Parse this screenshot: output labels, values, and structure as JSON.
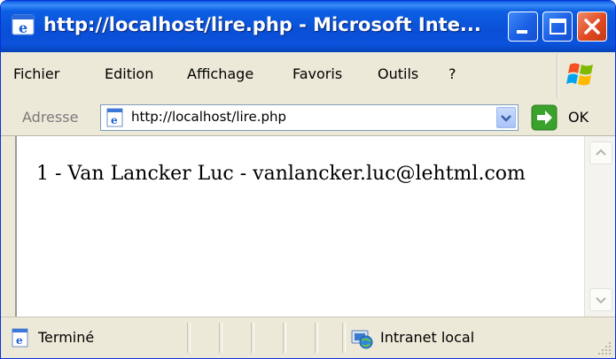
{
  "window": {
    "title": "http://localhost/lire.php - Microsoft Inte...",
    "title_bar_color": "#0a4fd6",
    "close_button_color": "#e04a22"
  },
  "menu": {
    "items": [
      {
        "label": "Fichier"
      },
      {
        "label": "Edition"
      },
      {
        "label": "Affichage"
      },
      {
        "label": "Favoris"
      },
      {
        "label": "Outils"
      },
      {
        "label": "?"
      }
    ]
  },
  "address_bar": {
    "label": "Adresse",
    "url": "http://localhost/lire.php",
    "go_label": "OK"
  },
  "content": {
    "rows": [
      {
        "text": "1 - Van Lancker Luc - vanlancker.luc@lehtml.com"
      }
    ]
  },
  "status_bar": {
    "status": "Terminé",
    "zone": "Intranet local"
  },
  "icons": {
    "app": "ie-logo-icon",
    "page": "ie-page-icon",
    "go": "go-arrow-icon",
    "zone": "intranet-globe-icon",
    "windows": "windows-flag-icon"
  }
}
